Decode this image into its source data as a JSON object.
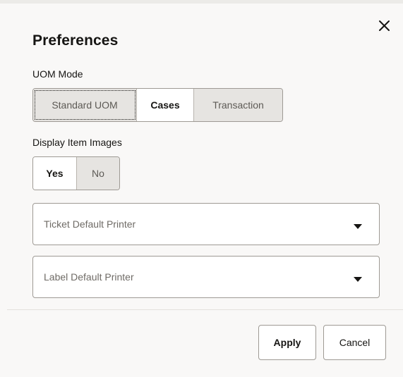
{
  "dialog": {
    "title": "Preferences",
    "close_icon": "close-icon"
  },
  "uom_mode": {
    "label": "UOM Mode",
    "options": [
      "Standard UOM",
      "Cases",
      "Transaction"
    ],
    "selected": "Cases"
  },
  "display_item_images": {
    "label": "Display Item Images",
    "options": [
      "Yes",
      "No"
    ],
    "selected": "Yes"
  },
  "ticket_printer": {
    "placeholder": "Ticket Default Printer",
    "icon": "caret-down-icon"
  },
  "label_printer": {
    "placeholder": "Label Default Printer",
    "icon": "caret-down-icon"
  },
  "footer": {
    "apply_label": "Apply",
    "cancel_label": "Cancel"
  },
  "colors": {
    "background": "#f9f8f7",
    "text": "#161513",
    "border": "#9e9a94",
    "unselected_segment": "#e6e4e1"
  }
}
